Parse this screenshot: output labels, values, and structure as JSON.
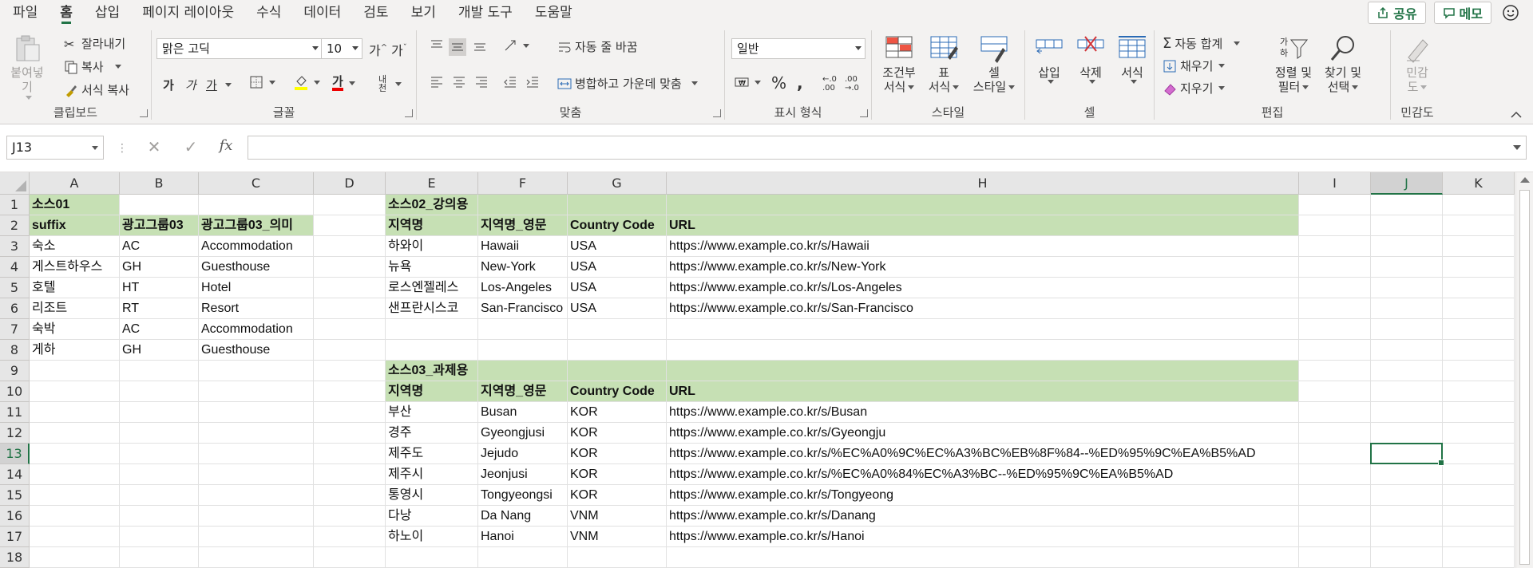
{
  "menu": {
    "tabs": [
      "파일",
      "홈",
      "삽입",
      "페이지 레이아웃",
      "수식",
      "데이터",
      "검토",
      "보기",
      "개발 도구",
      "도움말"
    ],
    "active_tab": "홈",
    "share_label": "공유",
    "memo_label": "메모"
  },
  "ribbon": {
    "clipboard": {
      "paste": "붙여넣기",
      "cut": "잘라내기",
      "copy": "복사",
      "format_painter": "서식 복사",
      "label": "클립보드"
    },
    "font": {
      "font_name": "맑은 고딕",
      "font_size": "10",
      "bold": "가",
      "italic": "가",
      "underline": "가",
      "font_color": "가",
      "phonetic": "내천",
      "label": "글꼴"
    },
    "alignment": {
      "wrap_text": "자동 줄 바꿈",
      "merge_center": "병합하고 가운데 맞춤",
      "label": "맞춤"
    },
    "number": {
      "format": "일반",
      "label": "표시 형식"
    },
    "styles": {
      "conditional": "조건부\n서식",
      "table": "표\n서식",
      "cell_styles": "셀\n스타일",
      "conditional_1": "조건부",
      "conditional_2": "서식",
      "table_1": "표",
      "table_2": "서식",
      "cell_1": "셀",
      "cell_2": "스타일",
      "label": "스타일"
    },
    "cells": {
      "insert": "삽입",
      "delete": "삭제",
      "format": "서식",
      "label": "셀"
    },
    "editing": {
      "autosum": "자동 합계",
      "fill": "채우기",
      "clear": "지우기",
      "sort_1": "정렬 및",
      "sort_2": "필터",
      "find_1": "찾기 및",
      "find_2": "선택",
      "label": "편집"
    },
    "sensitivity": {
      "line1": "민감",
      "line2": "도",
      "label": "민감도"
    }
  },
  "formula_bar": {
    "name_box": "J13",
    "fx": "fx",
    "formula": ""
  },
  "sheet": {
    "columns": [
      "A",
      "B",
      "C",
      "D",
      "E",
      "F",
      "G",
      "H",
      "I",
      "J",
      "K"
    ],
    "rows": [
      "1",
      "2",
      "3",
      "4",
      "5",
      "6",
      "7",
      "8",
      "9",
      "10",
      "11",
      "12",
      "13",
      "14",
      "15",
      "16",
      "17",
      "18"
    ],
    "selected_column": "J",
    "selected_row": "13",
    "src1": {
      "title": "소스01",
      "headers": [
        "suffix",
        "광고그룹03",
        "광고그룹03_의미"
      ],
      "rows": [
        [
          "숙소",
          "AC",
          "Accommodation"
        ],
        [
          "게스트하우스",
          "GH",
          "Guesthouse"
        ],
        [
          "호텔",
          "HT",
          "Hotel"
        ],
        [
          "리조트",
          "RT",
          "Resort"
        ],
        [
          "숙박",
          "AC",
          "Accommodation"
        ],
        [
          "게하",
          "GH",
          "Guesthouse"
        ]
      ]
    },
    "src2": {
      "title": "소스02_강의용",
      "headers": [
        "지역명",
        "지역명_영문",
        "Country Code",
        "URL"
      ],
      "rows": [
        [
          "하와이",
          "Hawaii",
          "USA",
          "https://www.example.co.kr/s/Hawaii"
        ],
        [
          "뉴욕",
          "New-York",
          "USA",
          "https://www.example.co.kr/s/New-York"
        ],
        [
          "로스엔젤레스",
          "Los-Angeles",
          "USA",
          "https://www.example.co.kr/s/Los-Angeles"
        ],
        [
          "샌프란시스코",
          "San-Francisco",
          "USA",
          "https://www.example.co.kr/s/San-Francisco"
        ]
      ]
    },
    "src3": {
      "title": "소스03_과제용",
      "headers": [
        "지역명",
        "지역명_영문",
        "Country Code",
        "URL"
      ],
      "rows": [
        [
          "부산",
          "Busan",
          "KOR",
          "https://www.example.co.kr/s/Busan"
        ],
        [
          "경주",
          "Gyeongjusi",
          "KOR",
          "https://www.example.co.kr/s/Gyeongju"
        ],
        [
          "제주도",
          "Jejudo",
          "KOR",
          "https://www.example.co.kr/s/%EC%A0%9C%EC%A3%BC%EB%8F%84--%ED%95%9C%EA%B5%AD"
        ],
        [
          "제주시",
          "Jeonjusi",
          "KOR",
          "https://www.example.co.kr/s/%EC%A0%84%EC%A3%BC--%ED%95%9C%EA%B5%AD"
        ],
        [
          "통영시",
          "Tongyeongsi",
          "KOR",
          "https://www.example.co.kr/s/Tongyeong"
        ],
        [
          "다낭",
          "Da Nang",
          "VNM",
          "https://www.example.co.kr/s/Danang"
        ],
        [
          "하노이",
          "Hanoi",
          "VNM",
          "https://www.example.co.kr/s/Hanoi"
        ]
      ]
    }
  },
  "colors": {
    "accent": "#217346",
    "header_fill": "#c6e0b4"
  }
}
